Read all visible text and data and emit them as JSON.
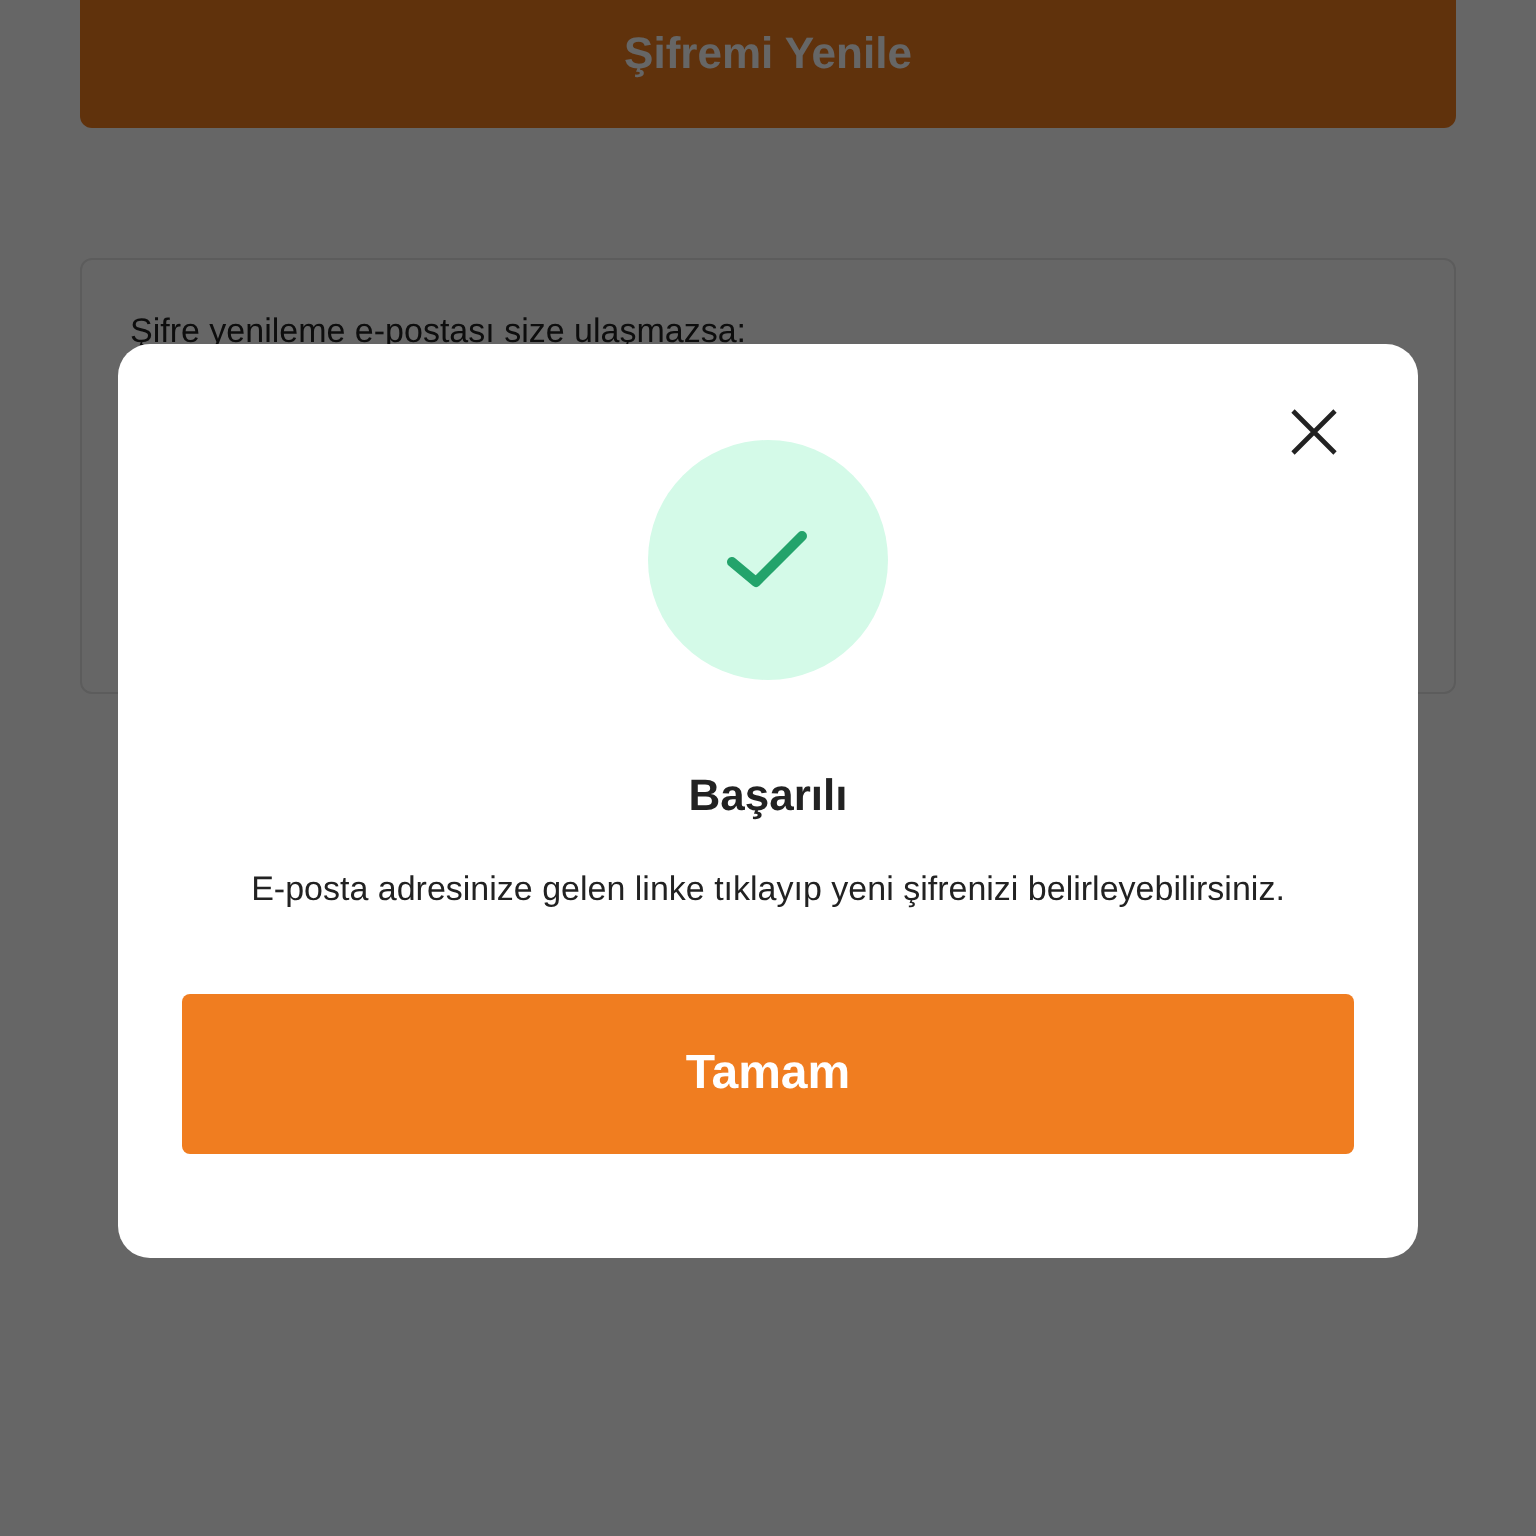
{
  "page": {
    "reset_button": "Şifremi Yenile",
    "help_card": {
      "text": "Şifre yenileme e-postası size ulaşmazsa:"
    }
  },
  "dialog": {
    "success": true,
    "title": "Başarılı",
    "message": "E-posta adresinize gelen linke tıklayıp yeni şifrenizi belirleyebilirsiniz.",
    "button": "Tamam"
  }
}
